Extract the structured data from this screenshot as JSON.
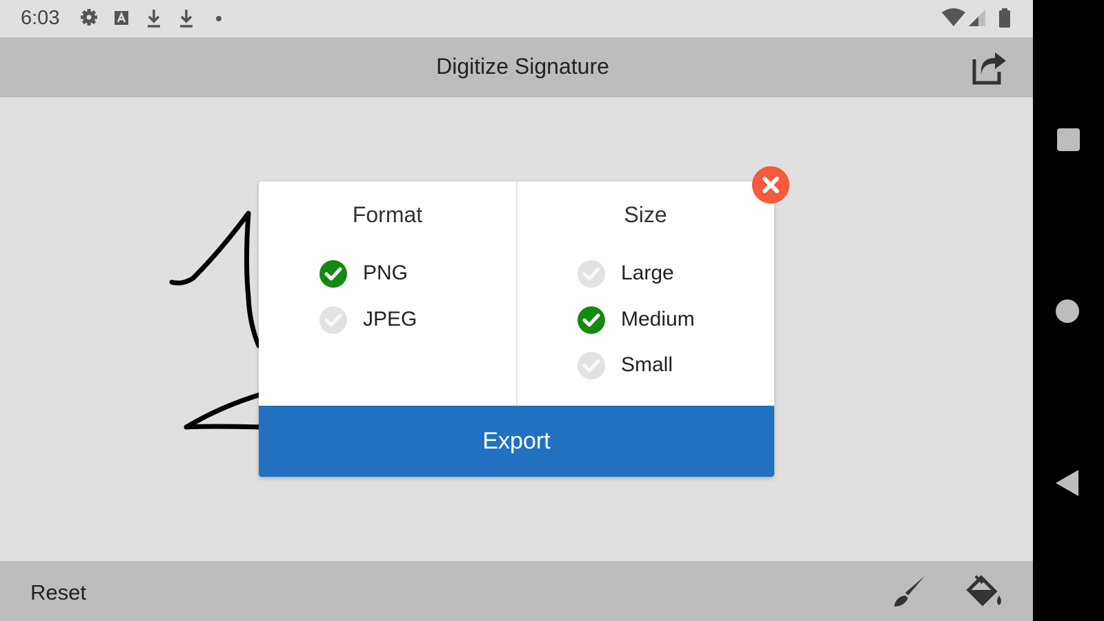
{
  "status_bar": {
    "time": "6:03",
    "left_icons": [
      "gear-icon",
      "font-box-icon",
      "download-icon",
      "download-icon",
      "dot-icon"
    ],
    "right_icons": [
      "wifi-icon",
      "signal-icon",
      "battery-icon"
    ]
  },
  "app_bar": {
    "title": "Digitize Signature",
    "share_icon": "share-icon"
  },
  "dialog": {
    "format": {
      "title": "Format",
      "options": [
        {
          "label": "PNG",
          "selected": true
        },
        {
          "label": "JPEG",
          "selected": false
        }
      ]
    },
    "size": {
      "title": "Size",
      "options": [
        {
          "label": "Large",
          "selected": false
        },
        {
          "label": "Medium",
          "selected": true
        },
        {
          "label": "Small",
          "selected": false
        }
      ]
    },
    "export_label": "Export",
    "close_icon": "close-icon"
  },
  "bottom_bar": {
    "reset_label": "Reset",
    "brush_icon": "brush-icon",
    "bucket_icon": "paint-bucket-icon"
  },
  "nav_bar": {
    "icons": [
      "recents-icon",
      "home-icon",
      "back-icon"
    ]
  },
  "colors": {
    "accent": "#2171c0",
    "check_selected": "#138a12",
    "check_unselected": "#e2e2e2",
    "close": "#f45a3b",
    "app_bar": "#bdbdbd",
    "background": "#e0e0e0"
  }
}
